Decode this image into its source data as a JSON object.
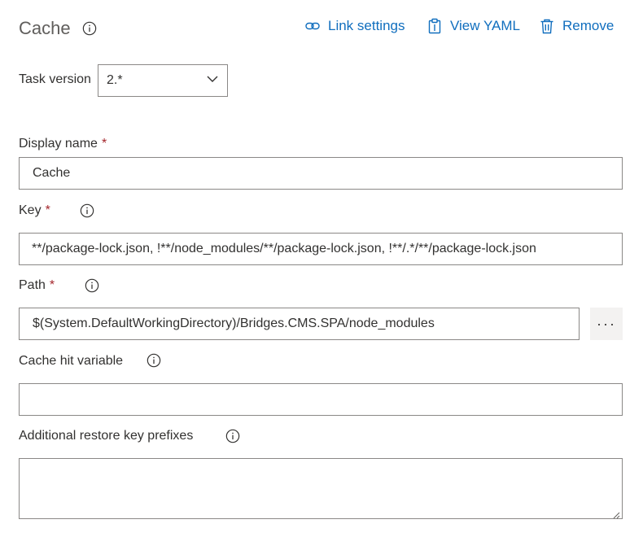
{
  "header": {
    "title": "Cache",
    "link_settings_label": "Link settings",
    "view_yaml_label": "View YAML",
    "remove_label": "Remove"
  },
  "task_version": {
    "label": "Task version",
    "value": "2.*"
  },
  "display_name": {
    "label": "Display name",
    "required": "*",
    "value": "Cache"
  },
  "key": {
    "label": "Key",
    "required": "*",
    "value": "**/package-lock.json, !**/node_modules/**/package-lock.json, !**/.*/**/package-lock.json"
  },
  "path": {
    "label": "Path",
    "required": "*",
    "value": "$(System.DefaultWorkingDirectory)/Bridges.CMS.SPA/node_modules",
    "browse_label": "···"
  },
  "cache_hit_variable": {
    "label": "Cache hit variable",
    "value": ""
  },
  "restore_keys": {
    "label": "Additional restore key prefixes",
    "value": ""
  },
  "colors": {
    "accent": "#106ebe",
    "required": "#a4262c",
    "border": "#8a8886"
  }
}
